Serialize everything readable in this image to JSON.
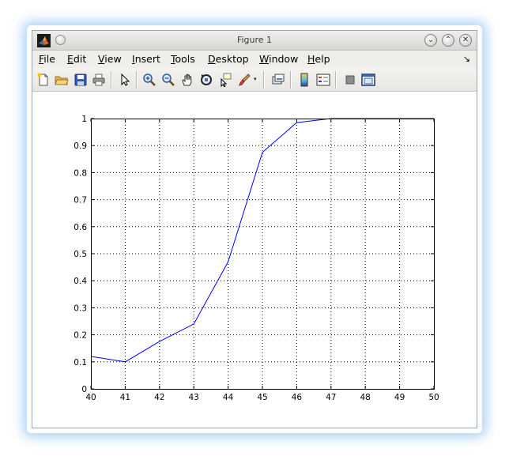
{
  "window": {
    "title": "Figure 1",
    "minimize_icon": "chevron-down-icon",
    "maximize_icon": "chevron-up-icon",
    "close_icon": "close-icon"
  },
  "menu": {
    "items": [
      {
        "label": "File",
        "key": "F",
        "rest": "ile"
      },
      {
        "label": "Edit",
        "key": "E",
        "rest": "dit"
      },
      {
        "label": "View",
        "key": "V",
        "rest": "iew"
      },
      {
        "label": "Insert",
        "key": "I",
        "rest": "nsert"
      },
      {
        "label": "Tools",
        "key": "T",
        "rest": "ools"
      },
      {
        "label": "Desktop",
        "key": "D",
        "rest": "esktop"
      },
      {
        "label": "Window",
        "key": "W",
        "rest": "indow"
      },
      {
        "label": "Help",
        "key": "H",
        "rest": "elp"
      }
    ],
    "dock_arrow": "↘"
  },
  "toolbar": {
    "icons": [
      "new-figure-icon",
      "open-file-icon",
      "save-icon",
      "print-icon",
      "edit-plot-arrow-icon",
      "zoom-in-icon",
      "zoom-out-icon",
      "pan-hand-icon",
      "rotate-3d-icon",
      "data-cursor-icon",
      "brush-icon",
      "link-plot-icon",
      "colorbar-icon",
      "legend-icon",
      "hide-plot-tools-icon",
      "show-plot-tools-icon"
    ],
    "caret": "▾"
  },
  "chart_data": {
    "type": "line",
    "x": [
      40,
      41,
      42,
      43,
      44,
      45,
      46,
      47,
      48,
      49,
      50
    ],
    "series": [
      {
        "values": [
          0.12,
          0.1,
          0.175,
          0.24,
          0.47,
          0.875,
          0.985,
          1.0,
          1.0,
          1.0,
          1.0
        ],
        "color": "#0000ff"
      }
    ],
    "xlim": [
      40,
      50
    ],
    "ylim": [
      0,
      1
    ],
    "xticks": [
      "40",
      "41",
      "42",
      "43",
      "44",
      "45",
      "46",
      "47",
      "48",
      "49",
      "50"
    ],
    "yticks": [
      "0",
      "0.1",
      "0.2",
      "0.3",
      "0.4",
      "0.5",
      "0.6",
      "0.7",
      "0.8",
      "0.9",
      "1"
    ],
    "grid": true,
    "grid_style": "dotted"
  }
}
